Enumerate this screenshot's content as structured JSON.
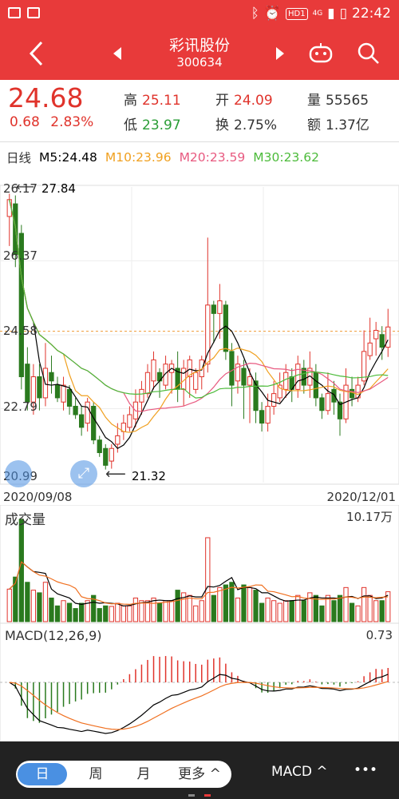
{
  "status_bar": {
    "time": "22:42",
    "network": "4G",
    "hd_badge": "HD1"
  },
  "nav": {
    "title": "彩讯股份",
    "code": "300634"
  },
  "quote": {
    "price": "24.68",
    "change": "0.68",
    "change_pct": "2.83%",
    "high_label": "高",
    "high": "25.11",
    "low_label": "低",
    "low": "23.97",
    "open_label": "开",
    "open": "24.09",
    "turnover_label": "换",
    "turnover": "2.75%",
    "volume_label": "量",
    "volume": "55565",
    "amount_label": "额",
    "amount": "1.37亿"
  },
  "ma_bar": {
    "period": "日线",
    "ma5": "M5:24.48",
    "ma10": "M10:23.96",
    "ma20": "M20:23.59",
    "ma30": "M30:23.62"
  },
  "colors": {
    "red": "#e0332b",
    "green": "#2a7a1e",
    "ma5": "#000000",
    "ma10": "#f0a020",
    "ma20": "#e85a80",
    "ma30": "#4cbb3a"
  },
  "kline": {
    "y_labels": [
      "26.17",
      "26.37",
      "24.58",
      "22.79",
      "20.99"
    ],
    "max_label": "27.84",
    "min_label": "21.32",
    "date_start": "2020/09/08",
    "date_end": "2020/12/01",
    "current_price_line": 24.58
  },
  "volume": {
    "title": "成交量",
    "max_label": "10.17万"
  },
  "macd": {
    "title": "MACD(12,26,9)",
    "max_label": "0.73"
  },
  "tabs": {
    "day": "日",
    "week": "周",
    "month": "月",
    "more": "更多 ^",
    "indicator": "MACD ^",
    "menu": "•••"
  },
  "chart_data": {
    "type": "candlestick",
    "ylim": [
      20.99,
      28.0
    ],
    "candles": [
      [
        27.3,
        27.7,
        26.6,
        27.84
      ],
      [
        27.6,
        26.4,
        26.1,
        27.8
      ],
      [
        26.9,
        23.5,
        23.2,
        27.1
      ],
      [
        23.8,
        22.9,
        22.7,
        24.2
      ],
      [
        22.9,
        23.5,
        22.6,
        23.8
      ],
      [
        23.5,
        23.0,
        22.7,
        23.8
      ],
      [
        23.0,
        23.7,
        22.8,
        24.3
      ],
      [
        23.6,
        23.4,
        23.1,
        24.0
      ],
      [
        23.3,
        23.0,
        22.9,
        23.5
      ],
      [
        22.9,
        23.3,
        22.7,
        23.5
      ],
      [
        23.2,
        22.8,
        22.6,
        23.3
      ],
      [
        22.8,
        22.6,
        22.5,
        23.0
      ],
      [
        22.6,
        22.3,
        22.1,
        22.8
      ],
      [
        22.4,
        22.9,
        22.2,
        23.0
      ],
      [
        22.8,
        22.0,
        21.9,
        22.9
      ],
      [
        22.0,
        21.7,
        21.6,
        22.1
      ],
      [
        21.8,
        21.4,
        21.3,
        21.9
      ],
      [
        21.5,
        21.8,
        21.32,
        21.9
      ],
      [
        21.9,
        22.1,
        21.7,
        22.4
      ],
      [
        22.2,
        22.4,
        22.0,
        22.6
      ],
      [
        22.3,
        22.6,
        22.2,
        22.8
      ],
      [
        22.5,
        22.9,
        22.3,
        23.2
      ],
      [
        22.9,
        23.2,
        22.6,
        23.4
      ],
      [
        23.1,
        23.6,
        23.0,
        23.8
      ],
      [
        23.4,
        23.9,
        23.2,
        24.1
      ],
      [
        23.6,
        23.4,
        23.0,
        23.7
      ],
      [
        23.3,
        23.8,
        23.2,
        24.0
      ],
      [
        23.6,
        23.8,
        23.1,
        23.9
      ],
      [
        23.7,
        23.2,
        22.9,
        24.1
      ],
      [
        23.2,
        23.7,
        22.8,
        23.9
      ],
      [
        23.5,
        23.9,
        23.0,
        24.0
      ],
      [
        23.2,
        23.6,
        23.1,
        23.7
      ],
      [
        23.5,
        23.9,
        23.2,
        24.0
      ],
      [
        23.8,
        25.2,
        23.6,
        26.8
      ],
      [
        25.2,
        25.0,
        24.3,
        25.3
      ],
      [
        25.0,
        25.3,
        24.4,
        25.7
      ],
      [
        25.2,
        24.1,
        23.9,
        25.3
      ],
      [
        24.1,
        23.3,
        22.8,
        24.3
      ],
      [
        23.4,
        23.8,
        23.1,
        24.0
      ],
      [
        23.7,
        23.3,
        22.5,
        23.9
      ],
      [
        23.3,
        23.5,
        22.4,
        23.7
      ],
      [
        23.4,
        22.7,
        22.4,
        23.6
      ],
      [
        22.7,
        22.4,
        22.2,
        22.9
      ],
      [
        22.4,
        22.8,
        22.2,
        23.1
      ],
      [
        22.8,
        23.1,
        22.6,
        23.4
      ],
      [
        23.0,
        23.3,
        22.9,
        23.6
      ],
      [
        23.2,
        23.6,
        23.0,
        23.8
      ],
      [
        23.5,
        23.2,
        22.9,
        23.7
      ],
      [
        23.2,
        23.8,
        23.0,
        24.0
      ],
      [
        23.7,
        23.3,
        23.1,
        23.9
      ],
      [
        23.3,
        23.7,
        23.0,
        24.1
      ],
      [
        23.6,
        23.0,
        22.8,
        23.8
      ],
      [
        23.0,
        22.7,
        22.5,
        23.1
      ],
      [
        22.7,
        23.1,
        22.6,
        23.6
      ],
      [
        23.2,
        22.9,
        22.6,
        23.4
      ],
      [
        22.9,
        22.5,
        22.1,
        23.1
      ],
      [
        22.5,
        23.3,
        22.4,
        23.7
      ],
      [
        23.2,
        23.0,
        22.8,
        23.5
      ],
      [
        23.0,
        23.3,
        22.9,
        23.5
      ],
      [
        23.4,
        24.1,
        23.3,
        24.6
      ],
      [
        24.0,
        24.3,
        23.9,
        24.9
      ],
      [
        24.4,
        24.6,
        24.0,
        24.8
      ],
      [
        24.5,
        24.2,
        23.9,
        24.7
      ],
      [
        24.2,
        24.68,
        23.97,
        25.11
      ]
    ],
    "ma5_label": "24.48",
    "ma10_label": "23.96",
    "ma20_label": "23.59",
    "ma30_label": "23.62"
  }
}
